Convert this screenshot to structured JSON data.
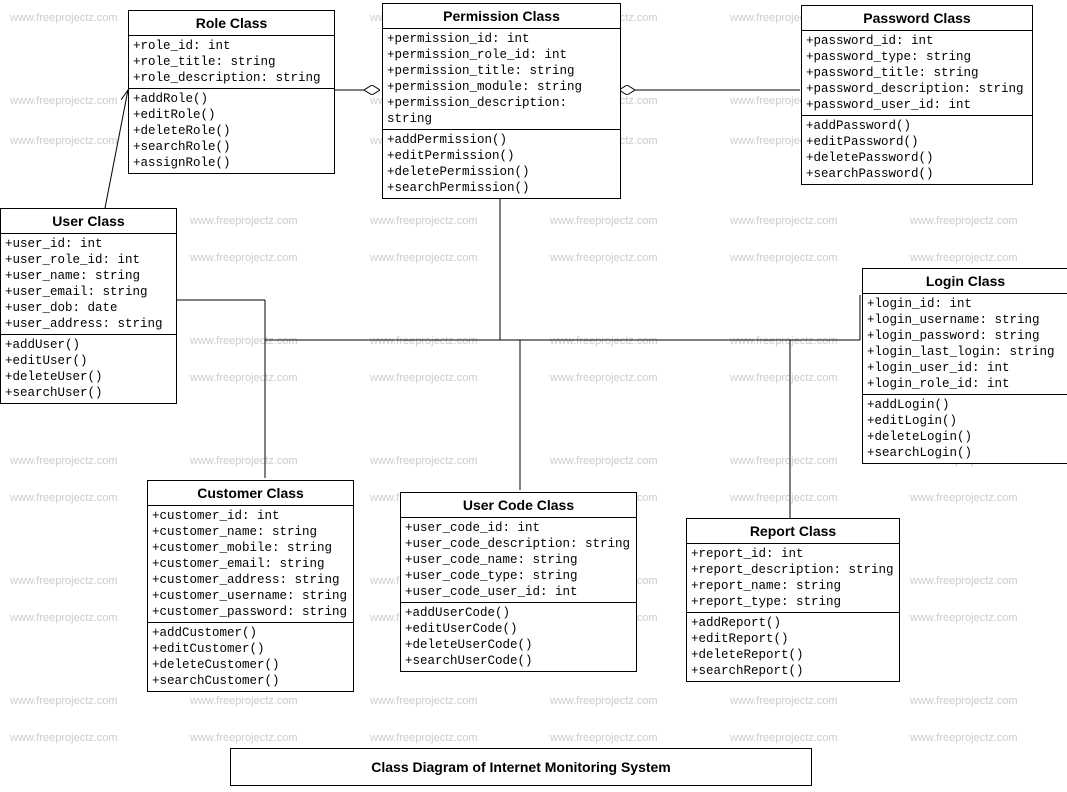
{
  "watermark_text": "www.freeprojectz.com",
  "diagram_title": "Class Diagram of Internet Monitoring System",
  "classes": {
    "role": {
      "title": "Role Class",
      "attrs": [
        "+role_id: int",
        "+role_title: string",
        "+role_description: string"
      ],
      "ops": [
        "+addRole()",
        "+editRole()",
        "+deleteRole()",
        "+searchRole()",
        "+assignRole()"
      ]
    },
    "permission": {
      "title": "Permission Class",
      "attrs": [
        "+permission_id: int",
        "+permission_role_id: int",
        "+permission_title: string",
        "+permission_module: string",
        "+permission_description: string"
      ],
      "ops": [
        "+addPermission()",
        "+editPermission()",
        "+deletePermission()",
        "+searchPermission()"
      ]
    },
    "password": {
      "title": "Password Class",
      "attrs": [
        "+password_id: int",
        "+password_type: string",
        "+password_title: string",
        "+password_description: string",
        "+password_user_id: int"
      ],
      "ops": [
        "+addPassword()",
        "+editPassword()",
        "+deletePassword()",
        "+searchPassword()"
      ]
    },
    "user": {
      "title": "User Class",
      "attrs": [
        "+user_id: int",
        "+user_role_id: int",
        "+user_name: string",
        "+user_email: string",
        "+user_dob: date",
        "+user_address: string"
      ],
      "ops": [
        "+addUser()",
        "+editUser()",
        "+deleteUser()",
        "+searchUser()"
      ]
    },
    "login": {
      "title": "Login Class",
      "attrs": [
        "+login_id: int",
        "+login_username: string",
        "+login_password: string",
        "+login_last_login: string",
        "+login_user_id: int",
        "+login_role_id: int"
      ],
      "ops": [
        "+addLogin()",
        "+editLogin()",
        "+deleteLogin()",
        "+searchLogin()"
      ]
    },
    "customer": {
      "title": "Customer Class",
      "attrs": [
        "+customer_id: int",
        "+customer_name: string",
        "+customer_mobile: string",
        "+customer_email: string",
        "+customer_address: string",
        "+customer_username: string",
        "+customer_password: string"
      ],
      "ops": [
        "+addCustomer()",
        "+editCustomer()",
        "+deleteCustomer()",
        "+searchCustomer()"
      ]
    },
    "usercode": {
      "title": "User Code Class",
      "attrs": [
        "+user_code_id: int",
        "+user_code_description: string",
        "+user_code_name: string",
        "+user_code_type: string",
        "+user_code_user_id: int"
      ],
      "ops": [
        "+addUserCode()",
        "+editUserCode()",
        "+deleteUserCode()",
        "+searchUserCode()"
      ]
    },
    "report": {
      "title": "Report Class",
      "attrs": [
        "+report_id: int",
        "+report_description: string",
        "+report_name: string",
        "+report_type: string"
      ],
      "ops": [
        "+addReport()",
        "+editReport()",
        "+deleteReport()",
        "+searchReport()"
      ]
    }
  }
}
